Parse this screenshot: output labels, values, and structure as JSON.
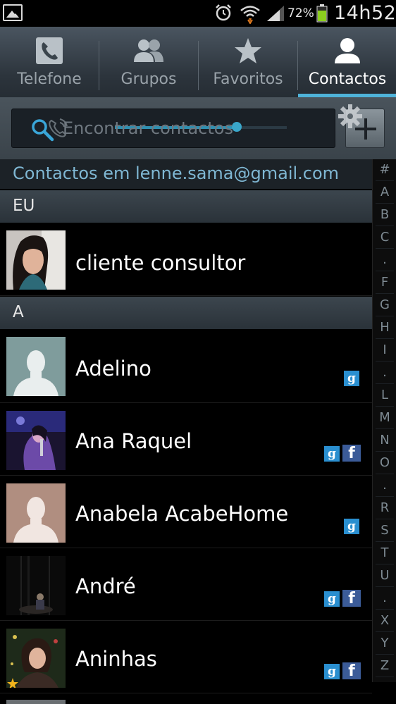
{
  "status_bar": {
    "battery_percent": "72%",
    "time": "14h52",
    "icons": [
      "gallery-icon",
      "alarm-icon",
      "wifi-icon",
      "signal-icon",
      "battery-icon"
    ]
  },
  "tabs": [
    {
      "label": "Telefone",
      "icon": "phone-icon"
    },
    {
      "label": "Grupos",
      "icon": "groups-icon"
    },
    {
      "label": "Favoritos",
      "icon": "star-icon"
    },
    {
      "label": "Contactos",
      "icon": "person-icon",
      "active": true
    }
  ],
  "search": {
    "placeholder": "Encontrar contactos"
  },
  "account_header": "Contactos em lenne.sama@gmail.com",
  "sections": [
    {
      "header": "EU"
    },
    {
      "header": "A"
    }
  ],
  "contacts": [
    {
      "name": "cliente consultor",
      "section": "EU",
      "badges": [],
      "avatar": "photo"
    },
    {
      "name": "Adelino",
      "section": "A",
      "badges": [
        "google"
      ],
      "avatar": "default-teal"
    },
    {
      "name": "Ana Raquel",
      "section": "A",
      "badges": [
        "google",
        "facebook"
      ],
      "avatar": "photo"
    },
    {
      "name": "Anabela AcabeHome",
      "section": "A",
      "badges": [
        "google"
      ],
      "avatar": "default-tan"
    },
    {
      "name": "André",
      "section": "A",
      "badges": [
        "google",
        "facebook"
      ],
      "avatar": "photo"
    },
    {
      "name": "Aninhas",
      "section": "A",
      "badges": [
        "google",
        "facebook"
      ],
      "avatar": "photo",
      "favorite": true
    }
  ],
  "badge_labels": {
    "google": "g",
    "facebook": "f"
  },
  "index_letters": [
    "#",
    "A",
    "B",
    "C",
    ".",
    "F",
    "G",
    "H",
    "I",
    ".",
    "L",
    "M",
    "N",
    "O",
    ".",
    "R",
    "S",
    "T",
    "U",
    ".",
    "X",
    "Y",
    "Z"
  ],
  "colors": {
    "accent": "#4fb3d9",
    "account_text": "#7fb7d3",
    "google_badge": "#2a8fd0",
    "facebook_badge": "#3b5b98",
    "favorite_star": "#f0b21c"
  }
}
